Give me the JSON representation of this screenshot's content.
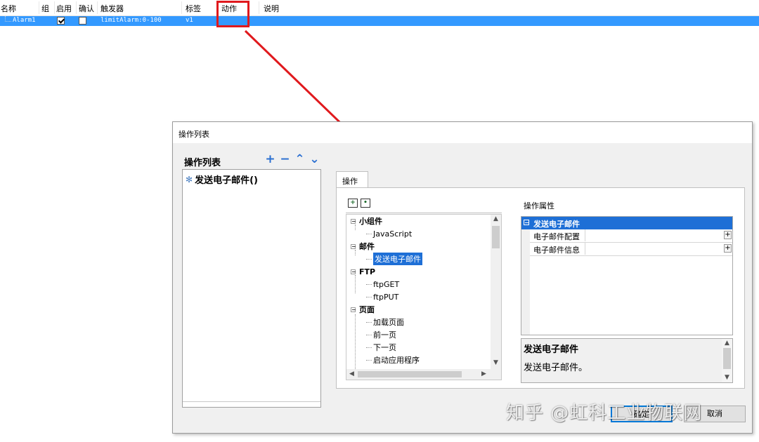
{
  "alarm_grid": {
    "columns": [
      "名称",
      "组",
      "启用",
      "确认",
      "触发器",
      "标签",
      "动作",
      "说明"
    ],
    "row": {
      "name": "Alarm1",
      "enabled": true,
      "confirm": false,
      "trigger": "limitAlarm:0-100",
      "tag": "v1"
    }
  },
  "annotation": {
    "color": "#e0191d"
  },
  "dialog": {
    "title": "操作列表",
    "list_heading": "操作列表",
    "tools": {
      "add": "+",
      "remove": "−",
      "up": "⌃",
      "down": "⌄"
    },
    "actions": [
      "发送电子邮件()"
    ],
    "tab_label": "操作",
    "tree": [
      {
        "type": "group",
        "label": "小组件"
      },
      {
        "type": "leaf",
        "label": "JavaScript"
      },
      {
        "type": "group",
        "label": "邮件"
      },
      {
        "type": "leaf",
        "label": "发送电子邮件",
        "selected": true
      },
      {
        "type": "group",
        "label": "FTP"
      },
      {
        "type": "leaf",
        "label": "ftpGET"
      },
      {
        "type": "leaf",
        "label": "ftpPUT"
      },
      {
        "type": "group",
        "label": "页面"
      },
      {
        "type": "leaf",
        "label": "加载页面"
      },
      {
        "type": "leaf",
        "label": "前一页"
      },
      {
        "type": "leaf",
        "label": "下一页"
      },
      {
        "type": "leaf",
        "label": "启动应用程序"
      }
    ],
    "properties": {
      "label": "操作属性",
      "category": "发送电子邮件",
      "rows": [
        "电子邮件配置",
        "电子邮件信息"
      ]
    },
    "description": {
      "title": "发送电子邮件",
      "text": "发送电子邮件。"
    },
    "buttons": {
      "ok": "确定",
      "cancel": "取消"
    }
  },
  "watermark": "知乎 @虹科工业物联网",
  "colors": {
    "selection": "#3399ff",
    "tree_selection": "#1e6fd6",
    "accent_icon": "#2a6fd1"
  }
}
